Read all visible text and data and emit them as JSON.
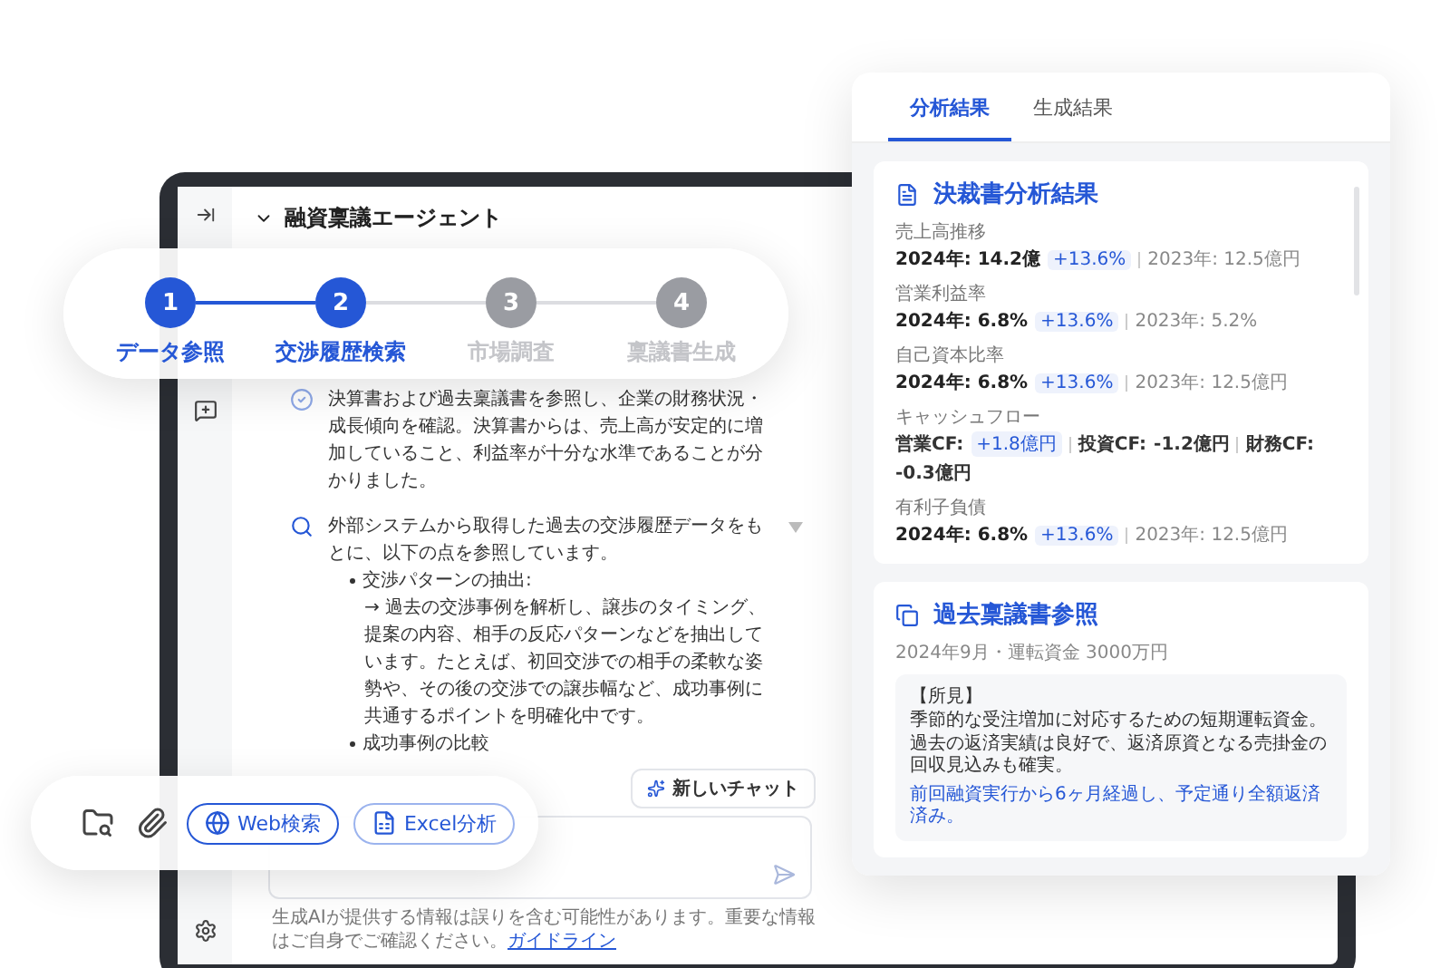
{
  "agent_header": {
    "title": "融資稟議エージェント"
  },
  "stepper": {
    "steps": [
      {
        "number": "1",
        "label": "データ参照",
        "reached": true
      },
      {
        "number": "2",
        "label": "交渉履歴検索",
        "reached": true
      },
      {
        "number": "3",
        "label": "市場調査",
        "reached": false
      },
      {
        "number": "4",
        "label": "稟議書生成",
        "reached": false
      }
    ]
  },
  "chat": {
    "messages": [
      {
        "kind": "done",
        "paragraph": "決算書および過去稟議書を参照し、企業の財務状況・成長傾向を確認。決算書からは、売上高が安定的に増加していること、利益率が十分な水準であることが分かりました。"
      },
      {
        "kind": "search",
        "paragraph": "外部システムから取得した過去の交渉履歴データをもとに、以下の点を参照しています。",
        "bullets": [
          {
            "title": "交渉パターンの抽出:",
            "detail": "→ 過去の交渉事例を解析し、譲歩のタイミング、提案の内容、相手の反応パターンなどを抽出しています。たとえば、初回交渉での相手の柔軟な姿勢や、その後の交渉での譲歩幅など、成功事例に共通するポイントを明確化中です。"
          },
          {
            "title": "成功事例の比較"
          }
        ]
      }
    ]
  },
  "new_chat_button": {
    "label": "新しいチャット"
  },
  "composer": {
    "chips": [
      {
        "label": "Web検索",
        "selected": true
      },
      {
        "label": "Excel分析",
        "selected": false
      }
    ]
  },
  "disclaimer": {
    "text": "生成AIが提供する情報は誤りを含む可能性があります。重要な情報はご自身でご確認ください。",
    "link": "ガイドライン"
  },
  "result_panel": {
    "tabs": [
      {
        "label": "分析結果",
        "selected": true
      },
      {
        "label": "生成結果",
        "selected": false
      }
    ],
    "analysis_card": {
      "title": "決裁書分析結果",
      "metrics": [
        {
          "kind": "comparison",
          "label": "売上高推移",
          "value": "2024年: 14.2億",
          "change": "+13.6%",
          "previous": "2023年: 12.5億円"
        },
        {
          "kind": "comparison",
          "label": "営業利益率",
          "value": "2024年: 6.8%",
          "change": "+13.6%",
          "previous": "2023年: 5.2%"
        },
        {
          "kind": "comparison",
          "label": "自己資本比率",
          "value": "2024年: 6.8%",
          "change": "+13.6%",
          "previous": "2023年: 12.5億円"
        },
        {
          "kind": "cashflow",
          "label": "キャッシュフロー",
          "items": [
            {
              "name": "営業CF:",
              "value": "+1.8億円",
              "highlighted": true
            },
            {
              "name": "投資CF:",
              "value": "-1.2億円",
              "highlighted": false
            },
            {
              "name": "財務CF:",
              "value": "-0.3億円",
              "highlighted": false
            }
          ]
        },
        {
          "kind": "comparison",
          "label": "有利子負債",
          "value": "2024年: 6.8%",
          "change": "+13.6%",
          "previous": "2023年: 12.5億円"
        }
      ]
    },
    "reference_card": {
      "title": "過去稟議書参照",
      "meta": "2024年9月・運転資金 3000万円",
      "findings_heading": "【所見】",
      "findings_lines": [
        "季節的な受注増加に対応するための短期運転資金。",
        "過去の返済実績は良好で、返済原資となる売掛金の回収見込みも確実。"
      ],
      "highlight": "前回融資実行から6ヶ月経過し、予定通り全額返済済み。"
    }
  }
}
